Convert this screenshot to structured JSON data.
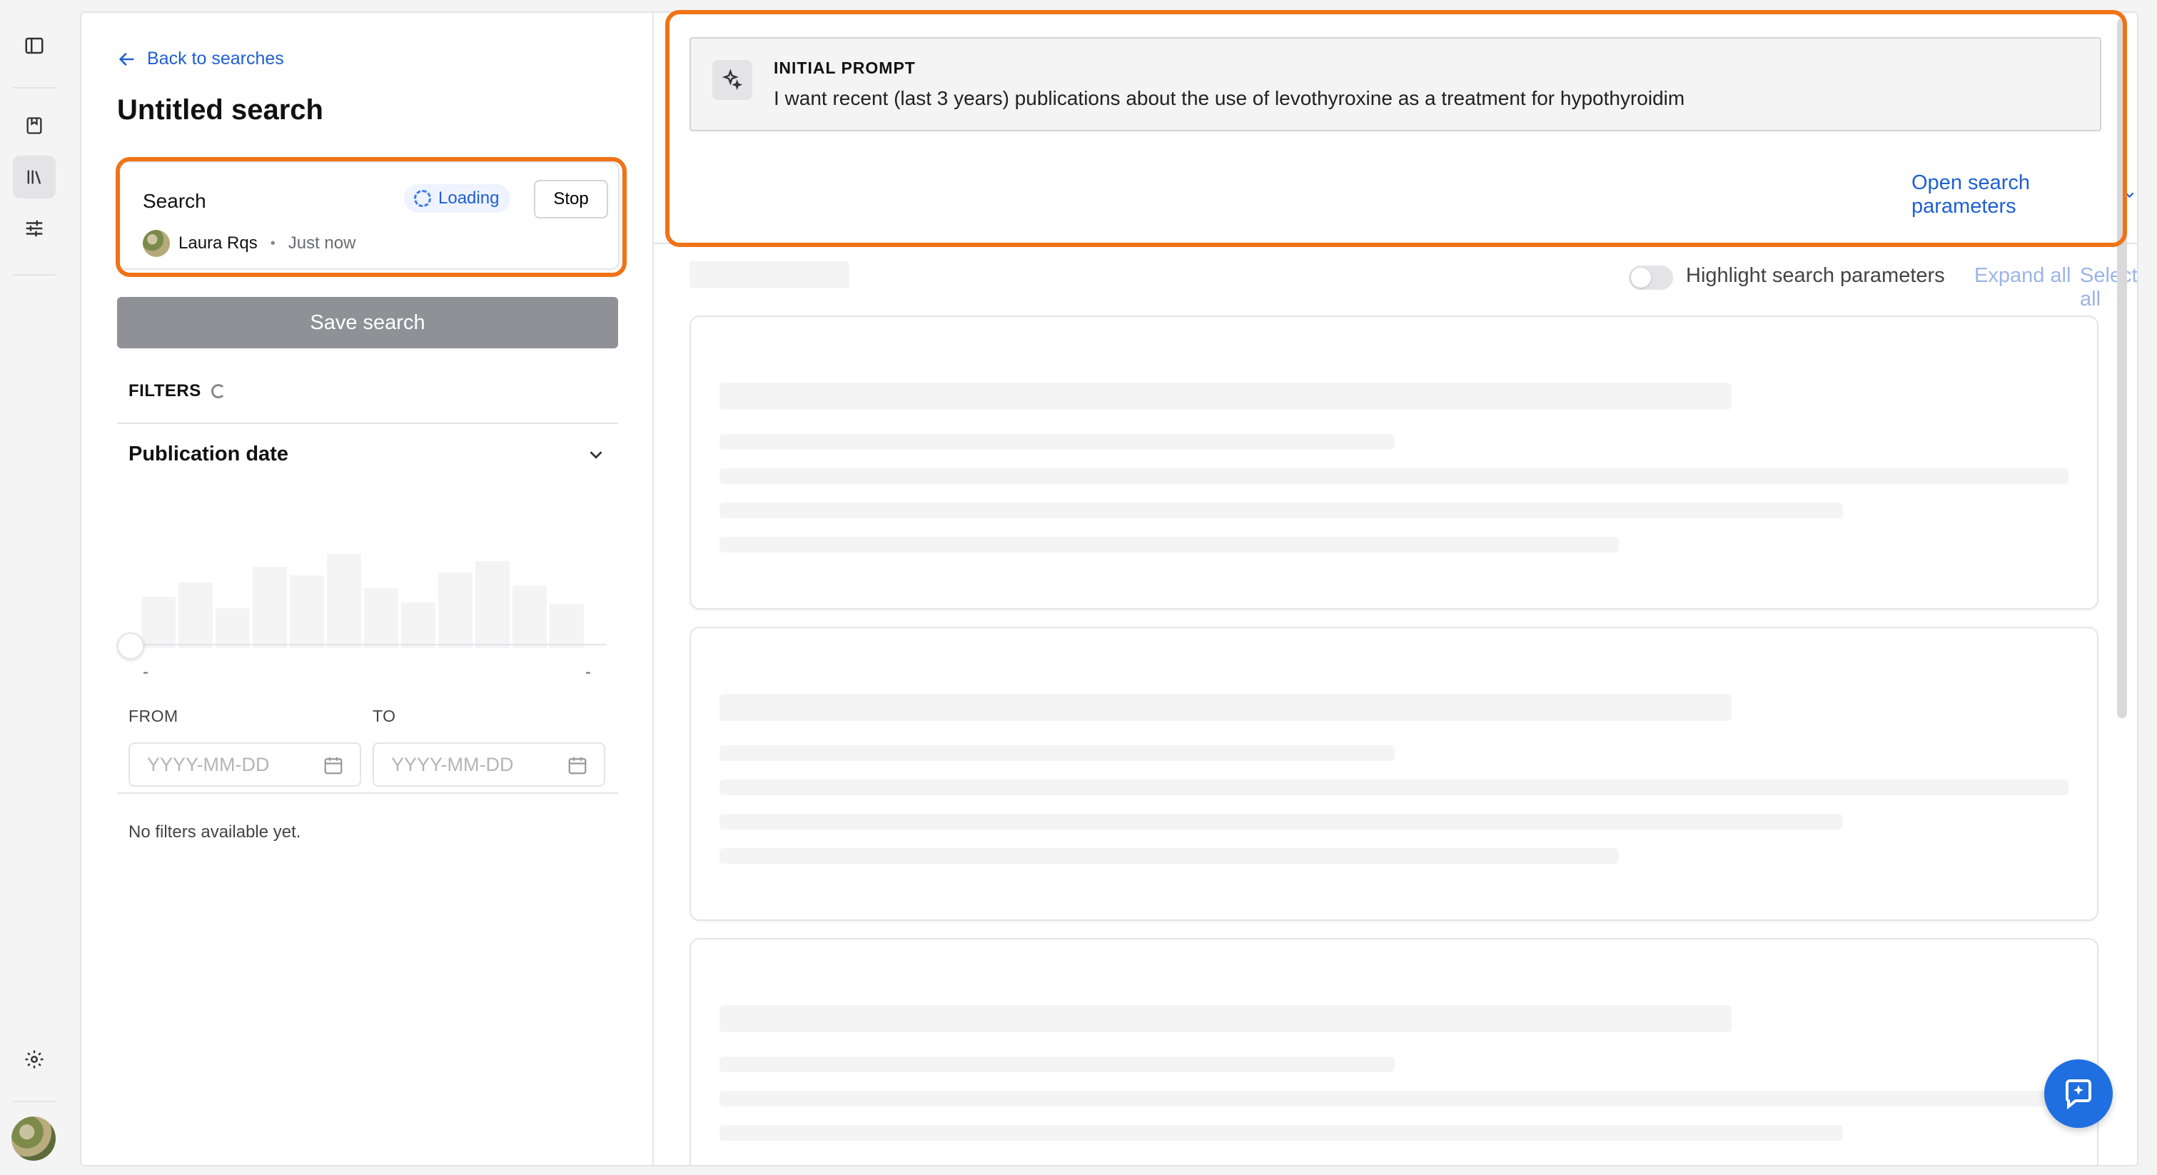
{
  "nav": {
    "back_label": "Back to searches"
  },
  "search": {
    "title": "Untitled search",
    "label": "Search",
    "status": "Loading",
    "stop_label": "Stop",
    "user_name": "Laura Rqs",
    "separator": "•",
    "time": "Just now",
    "save_label": "Save search"
  },
  "filters": {
    "heading": "FILTERS",
    "publication_date_label": "Publication date",
    "range_min_dash": "-",
    "range_max_dash": "-",
    "from_label": "FROM",
    "to_label": "TO",
    "from_placeholder": "YYYY-MM-DD",
    "to_placeholder": "YYYY-MM-DD",
    "empty_message": "No filters available yet."
  },
  "prompt": {
    "label": "INITIAL PROMPT",
    "text": "I want recent (last 3 years) publications about the use of levothyroxine as a treatment for hypothyroidim",
    "open_params_label": "Open search parameters"
  },
  "results": {
    "highlight_label": "Highlight search parameters",
    "highlight_on": false,
    "expand_all": "Expand all",
    "select_all": "Select all"
  },
  "colors": {
    "accent": "#1f5fd1",
    "highlight_outline": "#f07316",
    "skeleton": "#f4f4f5",
    "chat_button": "#1f6fe0"
  },
  "icons": {
    "rail": [
      "sidebar-toggle-icon",
      "bookmark-icon",
      "library-icon",
      "sliders-icon",
      "gear-icon"
    ],
    "back": "arrow-left-icon",
    "prompt": "sparkle-icon",
    "chat": "chat-sparkle-icon"
  }
}
